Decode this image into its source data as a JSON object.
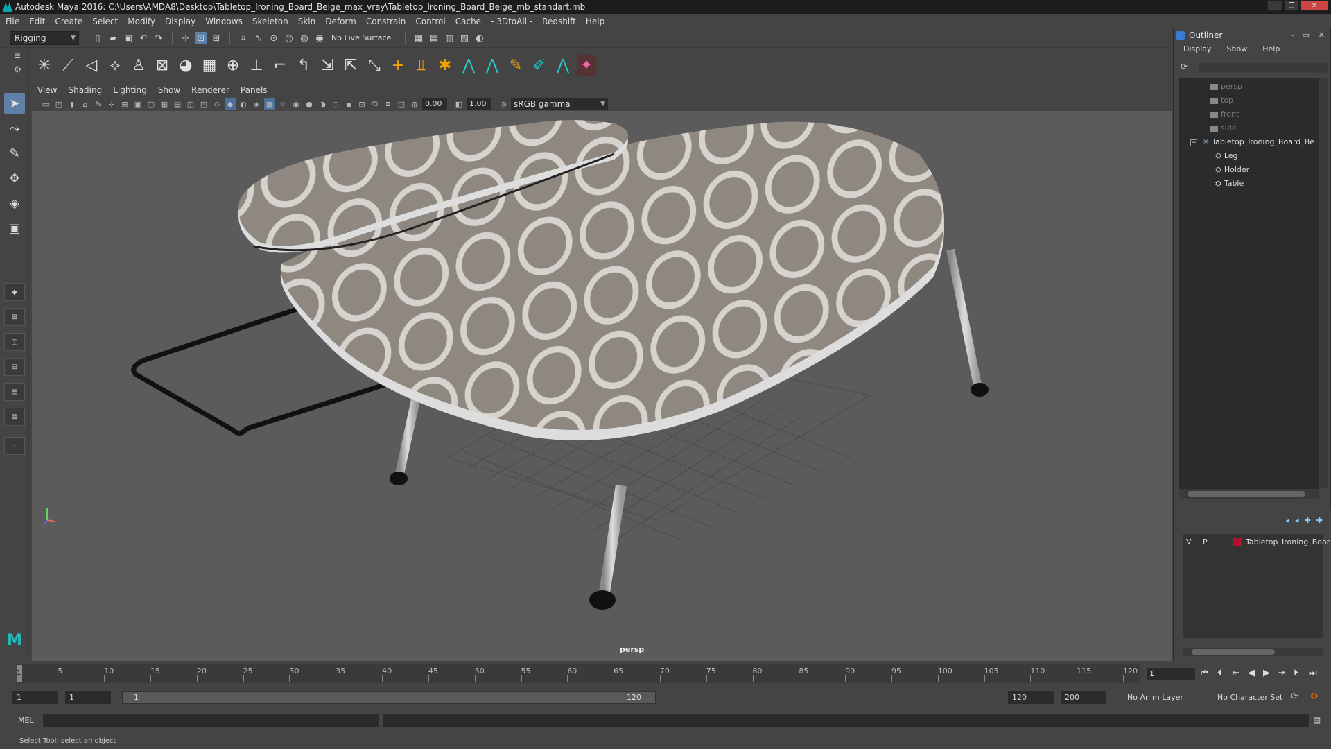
{
  "window": {
    "title": "Autodesk Maya 2016: C:\\Users\\AMDA8\\Desktop\\Tabletop_Ironing_Board_Beige_max_vray\\Tabletop_Ironing_Board_Beige_mb_standart.mb"
  },
  "menubar": [
    "File",
    "Edit",
    "Create",
    "Select",
    "Modify",
    "Display",
    "Windows",
    "Skeleton",
    "Skin",
    "Deform",
    "Constrain",
    "Control",
    "Cache",
    "- 3DtoAll -",
    "Redshift",
    "Help"
  ],
  "statusline": {
    "mode": "Rigging",
    "live_surface": "No Live Surface"
  },
  "panel": {
    "menus": [
      "View",
      "Shading",
      "Lighting",
      "Show",
      "Renderer",
      "Panels"
    ],
    "exposure": "0.00",
    "gamma_value": "1.00",
    "color_space": "sRGB gamma",
    "camera": "persp"
  },
  "outliner": {
    "title": "Outliner",
    "menus": [
      "Display",
      "Show",
      "Help"
    ],
    "items": [
      {
        "label": "persp",
        "kind": "camera"
      },
      {
        "label": "top",
        "kind": "camera"
      },
      {
        "label": "front",
        "kind": "camera"
      },
      {
        "label": "side",
        "kind": "camera"
      },
      {
        "label": "Tabletop_Ironing_Board_Be",
        "kind": "group"
      },
      {
        "label": "Leg",
        "kind": "mesh"
      },
      {
        "label": "Holder",
        "kind": "mesh"
      },
      {
        "label": "Table",
        "kind": "mesh"
      }
    ]
  },
  "layers": {
    "v": "V",
    "p": "P",
    "name": "Tabletop_Ironing_Boar",
    "color": "#b01030"
  },
  "timeslider": {
    "ticks": [
      "5",
      "10",
      "15",
      "20",
      "25",
      "30",
      "35",
      "40",
      "45",
      "50",
      "55",
      "60",
      "65",
      "70",
      "75",
      "80",
      "85",
      "90",
      "95",
      "100",
      "105",
      "110",
      "115",
      "120"
    ],
    "current_frame_marker": "1",
    "current_frame": "1"
  },
  "rangeslider": {
    "start": "1",
    "anim_start": "1",
    "range_start": "1",
    "range_end": "120",
    "end": "120",
    "anim_end": "200",
    "anim_layer": "No Anim Layer",
    "character_set": "No Character Set"
  },
  "cmdline": {
    "language": "MEL"
  },
  "helpline": {
    "text": "Select Tool: select an object"
  }
}
